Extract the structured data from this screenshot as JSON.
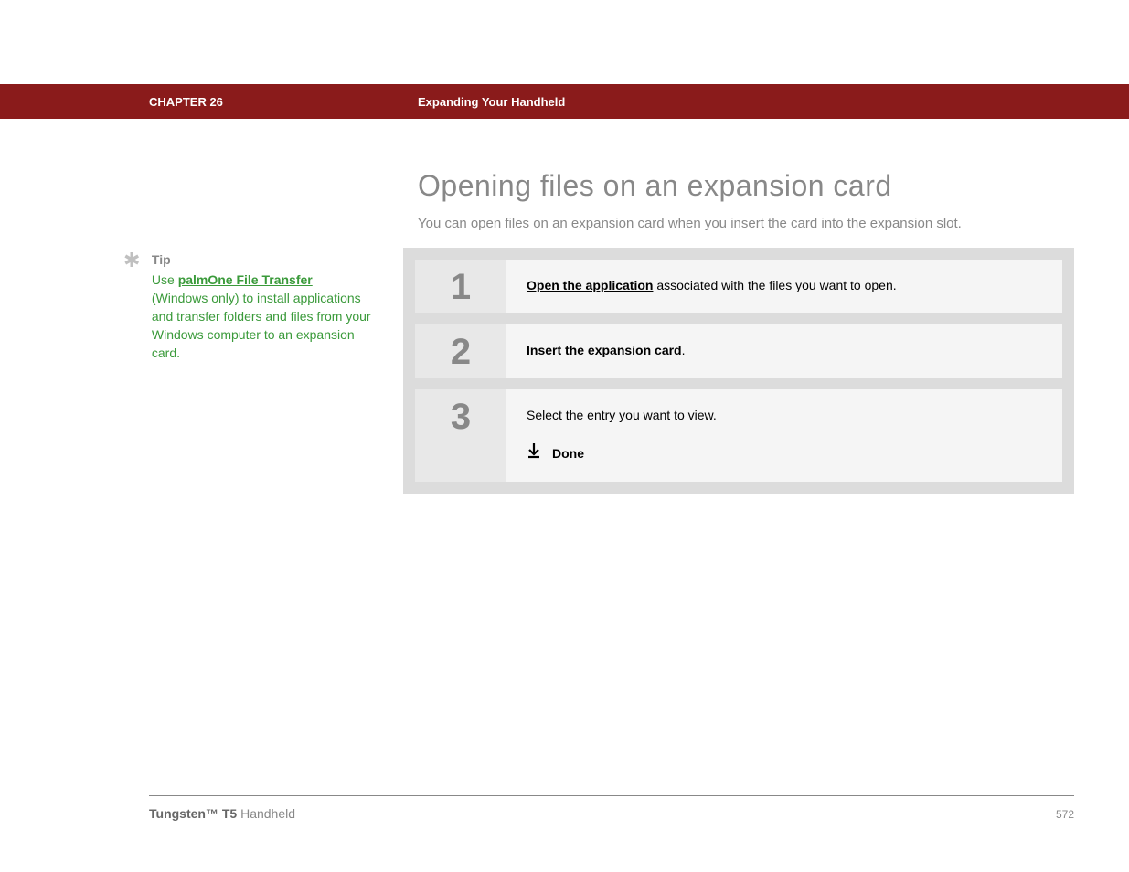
{
  "header": {
    "chapter": "CHAPTER 26",
    "title": "Expanding Your Handheld"
  },
  "main": {
    "heading": "Opening files on an expansion card",
    "intro": "You can open files on an expansion card when you insert the card into the expansion slot."
  },
  "tip": {
    "label": "Tip",
    "prefix": "Use ",
    "link_text": "palmOne File Transfer",
    "suffix": " (Windows only) to install applications and transfer folders and files from your Windows computer to an expansion card."
  },
  "steps": [
    {
      "number": "1",
      "link": "Open the application",
      "text": " associated with the files you want to open."
    },
    {
      "number": "2",
      "link": "Insert the expansion card",
      "text": "."
    },
    {
      "number": "3",
      "plain": "Select the entry you want to view.",
      "done": "Done"
    }
  ],
  "footer": {
    "product_bold": "Tungsten™ T5",
    "product_rest": " Handheld",
    "page": "572"
  }
}
